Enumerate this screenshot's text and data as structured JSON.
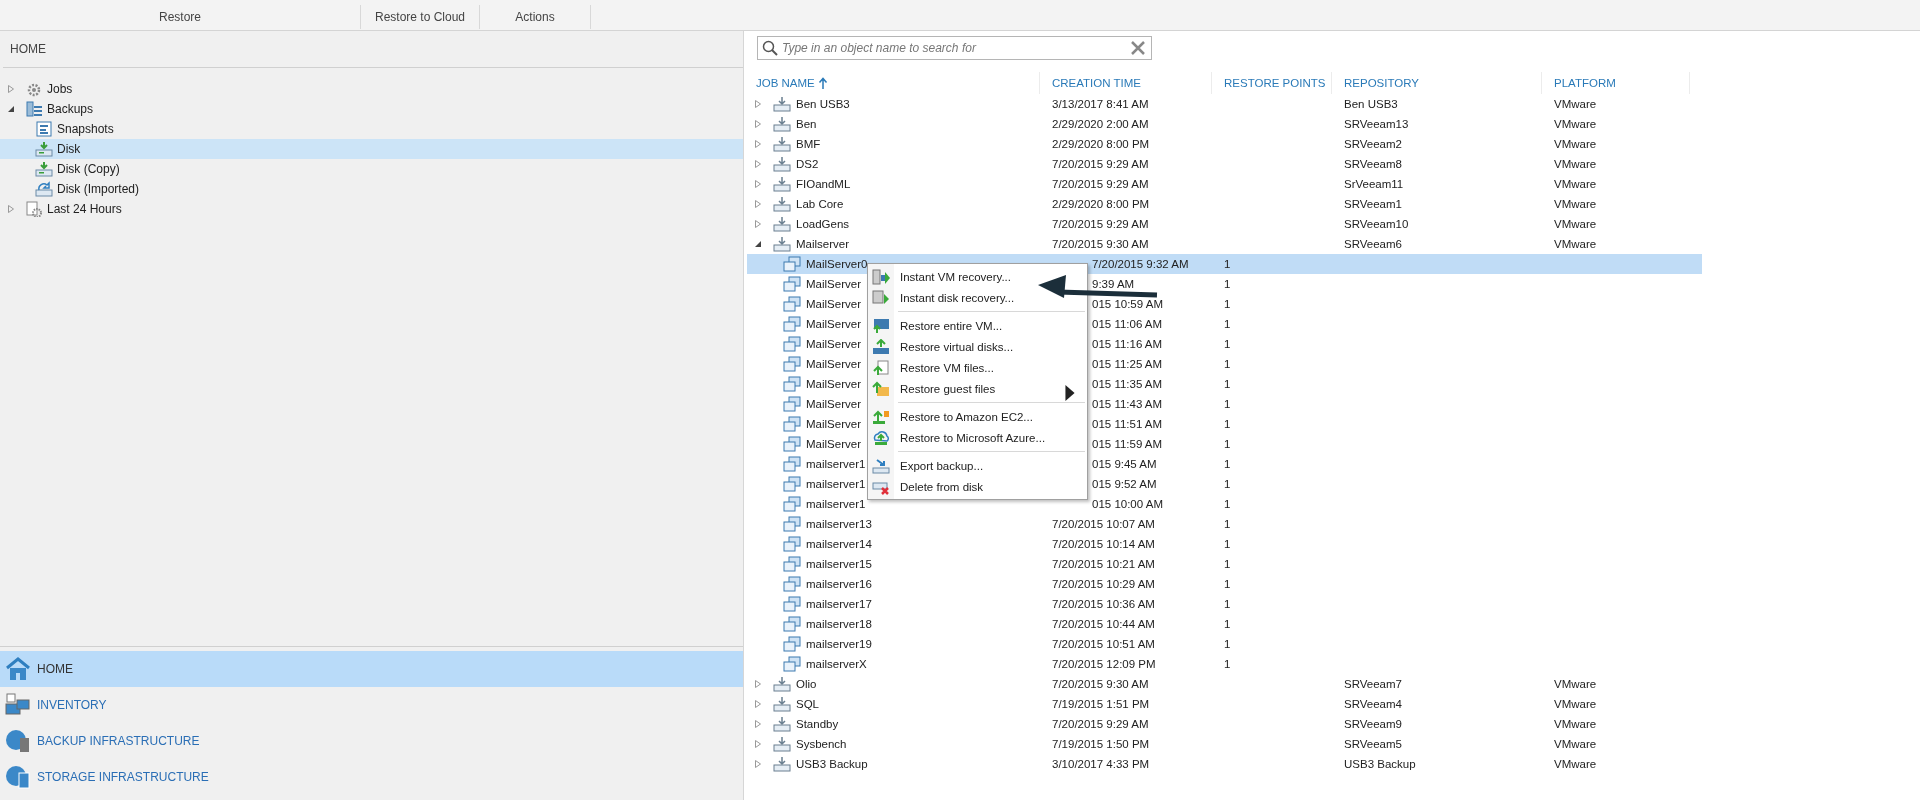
{
  "ribbon": {
    "groups": [
      {
        "label": "Restore"
      },
      {
        "label": "Restore to Cloud"
      },
      {
        "label": "Actions"
      }
    ]
  },
  "navigation": {
    "title": "HOME",
    "tree": [
      {
        "label": "Jobs",
        "expanded": false,
        "selected": false
      },
      {
        "label": "Backups",
        "expanded": true,
        "selected": false,
        "children": [
          {
            "label": "Snapshots",
            "selected": false
          },
          {
            "label": "Disk",
            "selected": true
          },
          {
            "label": "Disk (Copy)",
            "selected": false
          },
          {
            "label": "Disk (Imported)",
            "selected": false
          }
        ]
      },
      {
        "label": "Last 24 Hours",
        "expanded": false,
        "selected": false
      }
    ],
    "sections": [
      {
        "label": "HOME",
        "selected": true
      },
      {
        "label": "INVENTORY",
        "selected": false
      },
      {
        "label": "BACKUP INFRASTRUCTURE",
        "selected": false
      },
      {
        "label": "STORAGE INFRASTRUCTURE",
        "selected": false
      }
    ]
  },
  "search": {
    "placeholder": "Type in an object name to search for"
  },
  "table": {
    "columns": [
      "JOB NAME",
      "CREATION TIME",
      "RESTORE POINTS",
      "REPOSITORY",
      "PLATFORM"
    ],
    "rows": [
      {
        "name": "Ben USB3",
        "time": "3/13/2017 8:41 AM",
        "repository": "Ben USB3",
        "platform": "VMware",
        "expanded": false
      },
      {
        "name": "Ben",
        "time": "2/29/2020 2:00 AM",
        "repository": "SRVeeam13",
        "platform": "VMware",
        "expanded": false
      },
      {
        "name": "BMF",
        "time": "2/29/2020 8:00 PM",
        "repository": "SRVeeam2",
        "platform": "VMware",
        "expanded": false
      },
      {
        "name": "DS2",
        "time": "7/20/2015 9:29 AM",
        "repository": "SRVeeam8",
        "platform": "VMware",
        "expanded": false
      },
      {
        "name": "FIOandML",
        "time": "7/20/2015 9:29 AM",
        "repository": "SrVeeam11",
        "platform": "VMware",
        "expanded": false
      },
      {
        "name": "Lab Core",
        "time": "2/29/2020 8:00 PM",
        "repository": "SRVeeam1",
        "platform": "VMware",
        "expanded": false
      },
      {
        "name": "LoadGens",
        "time": "7/20/2015 9:29 AM",
        "repository": "SRVeeam10",
        "platform": "VMware",
        "expanded": false
      },
      {
        "name": "Mailserver",
        "time": "7/20/2015 9:30 AM",
        "repository": "SRVeeam6",
        "platform": "VMware",
        "expanded": true,
        "children": [
          {
            "name": "MailServer0",
            "time": "7/20/2015 9:32 AM",
            "points": "1",
            "selected": true
          },
          {
            "name": "MailServer",
            "time": "9:39 AM",
            "points": "1",
            "selected": false
          },
          {
            "name": "MailServer",
            "time": "015 10:59 AM",
            "points": "1",
            "selected": false
          },
          {
            "name": "MailServer",
            "time": "015 11:06 AM",
            "points": "1",
            "selected": false
          },
          {
            "name": "MailServer",
            "time": "015 11:16 AM",
            "points": "1",
            "selected": false
          },
          {
            "name": "MailServer",
            "time": "015 11:25 AM",
            "points": "1",
            "selected": false
          },
          {
            "name": "MailServer",
            "time": "015 11:35 AM",
            "points": "1",
            "selected": false
          },
          {
            "name": "MailServer",
            "time": "015 11:43 AM",
            "points": "1",
            "selected": false
          },
          {
            "name": "MailServer",
            "time": "015 11:51 AM",
            "points": "1",
            "selected": false
          },
          {
            "name": "MailServer",
            "time": "015 11:59 AM",
            "points": "1",
            "selected": false
          },
          {
            "name": "mailserver1",
            "time": "015 9:45 AM",
            "points": "1",
            "selected": false
          },
          {
            "name": "mailserver1",
            "time": "015 9:52 AM",
            "points": "1",
            "selected": false
          },
          {
            "name": "mailserver1",
            "time": "015 10:00 AM",
            "points": "1",
            "selected": false
          },
          {
            "name": "mailserver13",
            "time": "7/20/2015 10:07 AM",
            "points": "1",
            "selected": false
          },
          {
            "name": "mailserver14",
            "time": "7/20/2015 10:14 AM",
            "points": "1",
            "selected": false
          },
          {
            "name": "mailserver15",
            "time": "7/20/2015 10:21 AM",
            "points": "1",
            "selected": false
          },
          {
            "name": "mailserver16",
            "time": "7/20/2015 10:29 AM",
            "points": "1",
            "selected": false
          },
          {
            "name": "mailserver17",
            "time": "7/20/2015 10:36 AM",
            "points": "1",
            "selected": false
          },
          {
            "name": "mailserver18",
            "time": "7/20/2015 10:44 AM",
            "points": "1",
            "selected": false
          },
          {
            "name": "mailserver19",
            "time": "7/20/2015 10:51 AM",
            "points": "1",
            "selected": false
          },
          {
            "name": "mailserverX",
            "time": "7/20/2015 12:09 PM",
            "points": "1",
            "selected": false
          }
        ]
      },
      {
        "name": "Olio",
        "time": "7/20/2015 9:30 AM",
        "repository": "SRVeeam7",
        "platform": "VMware",
        "expanded": false
      },
      {
        "name": "SQL",
        "time": "7/19/2015 1:51 PM",
        "repository": "SRVeeam4",
        "platform": "VMware",
        "expanded": false
      },
      {
        "name": "Standby",
        "time": "7/20/2015 9:29 AM",
        "repository": "SRVeeam9",
        "platform": "VMware",
        "expanded": false
      },
      {
        "name": "Sysbench",
        "time": "7/19/2015 1:50 PM",
        "repository": "SRVeeam5",
        "platform": "VMware",
        "expanded": false
      },
      {
        "name": "USB3 Backup",
        "time": "3/10/2017 4:33 PM",
        "repository": "USB3 Backup",
        "platform": "VMware",
        "expanded": false
      }
    ]
  },
  "context_menu": {
    "groups": [
      [
        {
          "label": "Instant VM recovery...",
          "has_submenu": false
        },
        {
          "label": "Instant disk recovery...",
          "has_submenu": false
        }
      ],
      [
        {
          "label": "Restore entire VM...",
          "has_submenu": false
        },
        {
          "label": "Restore virtual disks...",
          "has_submenu": false
        },
        {
          "label": "Restore VM files...",
          "has_submenu": false
        },
        {
          "label": "Restore guest files",
          "has_submenu": true
        }
      ],
      [
        {
          "label": "Restore to Amazon EC2...",
          "has_submenu": false
        },
        {
          "label": "Restore to Microsoft Azure...",
          "has_submenu": false
        }
      ],
      [
        {
          "label": "Export backup...",
          "has_submenu": false
        },
        {
          "label": "Delete from disk",
          "has_submenu": false
        }
      ]
    ]
  }
}
